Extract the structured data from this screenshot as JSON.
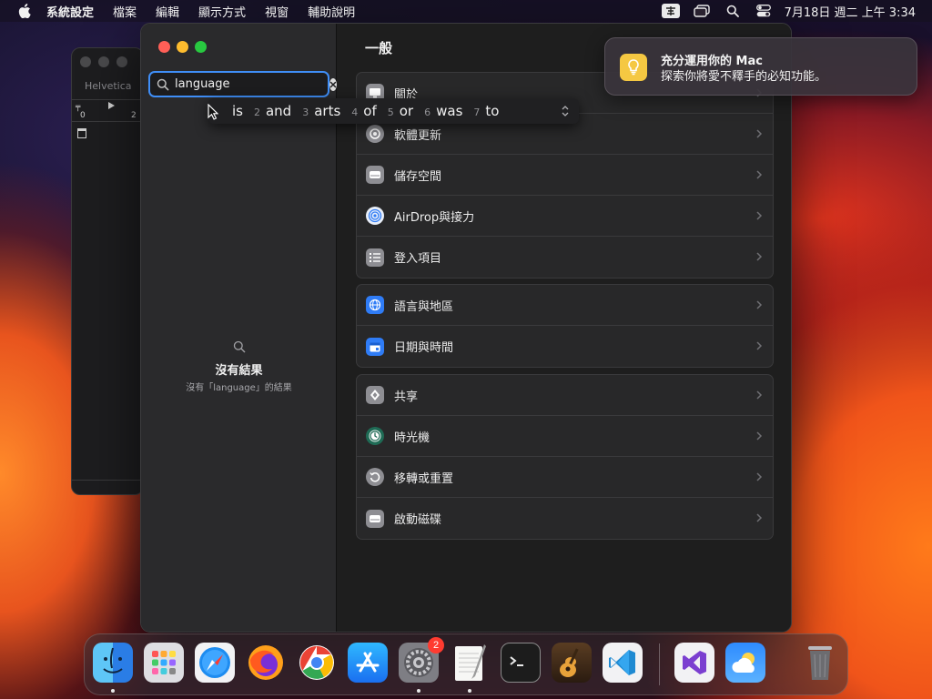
{
  "menubar": {
    "app_name": "系統設定",
    "items": [
      "檔案",
      "編輯",
      "顯示方式",
      "視窗",
      "輔助說明"
    ],
    "clock": "7月18日 週二 上午 3:34"
  },
  "background_window": {
    "title": "Helvetica",
    "ruler_start": "0",
    "ruler_mark": "2"
  },
  "sidebar": {
    "search": {
      "value": "language"
    },
    "no_results": {
      "title": "沒有結果",
      "subtitle": "沒有「language」的結果"
    }
  },
  "content": {
    "title": "一般",
    "groups": [
      {
        "items": [
          {
            "label": "關於",
            "icon": "about-icon"
          },
          {
            "label": "軟體更新",
            "icon": "software-update-icon"
          },
          {
            "label": "儲存空間",
            "icon": "storage-icon"
          },
          {
            "label": "AirDrop與接力",
            "icon": "airdrop-icon"
          },
          {
            "label": "登入項目",
            "icon": "login-items-icon"
          }
        ]
      },
      {
        "items": [
          {
            "label": "語言與地區",
            "icon": "globe-icon"
          },
          {
            "label": "日期與時間",
            "icon": "calendar-icon"
          }
        ]
      },
      {
        "items": [
          {
            "label": "共享",
            "icon": "sharing-icon"
          },
          {
            "label": "時光機",
            "icon": "time-machine-icon"
          },
          {
            "label": "移轉或重置",
            "icon": "reset-icon"
          },
          {
            "label": "啟動磁碟",
            "icon": "startup-disk-icon"
          }
        ]
      }
    ]
  },
  "candidates": [
    {
      "num": "",
      "word": "is"
    },
    {
      "num": "2",
      "word": "and"
    },
    {
      "num": "3",
      "word": "arts"
    },
    {
      "num": "4",
      "word": "of"
    },
    {
      "num": "5",
      "word": "or"
    },
    {
      "num": "6",
      "word": "was"
    },
    {
      "num": "7",
      "word": "to"
    }
  ],
  "notification": {
    "title": "充分運用你的 Mac",
    "body": "探索你將愛不釋手的必知功能。"
  },
  "dock": {
    "settings_badge": "2",
    "apps": [
      "finder-icon",
      "launchpad-icon",
      "safari-icon",
      "firefox-icon",
      "chrome-icon",
      "app-store-icon",
      "system-settings-icon",
      "textedit-icon",
      "terminal-icon",
      "garageband-icon",
      "vscode-icon",
      "visual-studio-icon",
      "weather-icon",
      "trash-icon"
    ]
  },
  "colors": {
    "accent": "#3f8ef7",
    "close": "#ff5f57",
    "minimize": "#febc2e",
    "zoom": "#28c840",
    "badge": "#ff3b30"
  }
}
